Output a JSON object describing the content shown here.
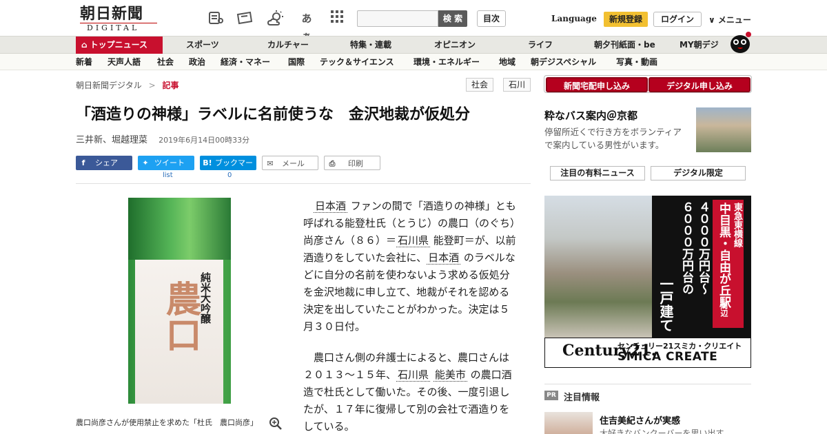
{
  "header": {
    "logo_main": "朝日新聞",
    "logo_sub": "DIGITAL",
    "search_button": "検 索",
    "toc_button": "目次",
    "language": "Language",
    "register": "新規登録",
    "login": "ログイン",
    "menu": "∨ メニュー",
    "icon_hiragana": "あぁ"
  },
  "nav_primary": [
    "トップニュース",
    "スポーツ",
    "カルチャー",
    "特集・連載",
    "オピニオン",
    "ライフ",
    "朝夕刊紙面・be",
    "MY朝デジ"
  ],
  "nav_secondary": [
    "新着",
    "天声人語",
    "社会",
    "政治",
    "経済・マネー",
    "国際",
    "テック＆サイエンス",
    "環境・エネルギー",
    "地域",
    "朝デジスペシャル",
    "写真・動画"
  ],
  "breadcrumb": {
    "home": "朝日新聞デジタル",
    "sep": ">",
    "current": "記事"
  },
  "tags": [
    "社会",
    "石川"
  ],
  "article": {
    "title": "「酒造りの神様」ラベルに名前使うな　金沢地裁が仮処分",
    "authors": "三井新、堀越理菜",
    "date": "2019年6月14日00時33分",
    "share": {
      "facebook": "シェア",
      "twitter": "ツイート",
      "hatena": "ブックマーク",
      "mail": "メール",
      "print": "印刷",
      "twitter_sub": "list",
      "hatena_count": "0"
    },
    "photo_caption": "農口尚彦さんが使用禁止を求めた「杜氏　農口尚彦」",
    "photo_label_text": "純米大吟醸",
    "photo_brand": "農口",
    "p1": {
      "kw1": "日本酒",
      "t1": " ファンの間で「酒造りの神様」とも呼ばれる能登杜氏（とうじ）の農口（のぐち）尚彦さん（８６）＝",
      "kw2": "石川県",
      "t2": " 能登町＝が、以前酒造りをしていた会社に、",
      "kw3": "日本酒",
      "t3": " のラベルなどに自分の名前を使わないよう求める仮処分を金沢地裁に申し立て、地裁がそれを認める決定を出していたことがわかった。決定は５月３０日付。"
    },
    "p2": {
      "t1": "農口さん側の弁護士によると、農口さんは２０１３～１５年、",
      "kw1": "石川県",
      "kw2": "能美市",
      "t2": " の農口酒造で杜氏として働いた。その後、一度引退したが、１７年に復帰して別の会社で酒造りをしている。"
    }
  },
  "sidebar": {
    "btn_paper": "新聞宅配申し込み",
    "btn_digital": "デジタル申し込み",
    "promo_title": "粋なバス案内＠京都",
    "promo_desc": "停留所近くで行き方をボランティアで案内している男性がいます。",
    "tab1": "注目の有料ニュース",
    "tab2": "デジタル限定",
    "ad": {
      "line_red": "東急東横線",
      "line_main": "中目黒・自由が丘駅",
      "line_sub": "周辺",
      "price": "４０００万円台～６０００万円台の",
      "house": "一戸建て",
      "logo": "Century21.",
      "company_small": "センチュリー21スミカ・クリエイト",
      "company": "SMICA CREATE"
    },
    "pr_badge": "PR",
    "pr_heading": "注目情報",
    "pr_title": "住吉美紀さんが実感",
    "pr_desc": "大好きなバンクーバーを思い出す"
  }
}
